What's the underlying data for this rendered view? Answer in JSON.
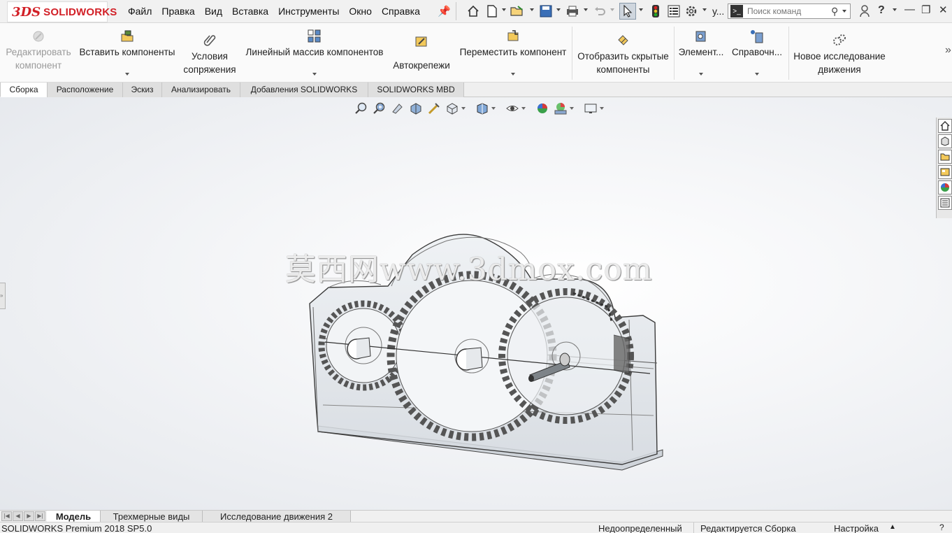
{
  "app": {
    "brand_mark": "3DS",
    "brand_name": "SOLIDWORKS"
  },
  "menu": [
    "Файл",
    "Правка",
    "Вид",
    "Вставка",
    "Инструменты",
    "Окно",
    "Справка"
  ],
  "quick_access": {
    "truncated_label": "у..."
  },
  "search": {
    "placeholder": "Поиск команд"
  },
  "command_manager": {
    "edit_component": "Редактировать компонент",
    "insert_components": "Вставить компоненты",
    "mate": "Условия сопряжения",
    "linear_pattern": "Линейный массив компонентов",
    "smart_fasteners": "Автокрепежи",
    "move_component": "Переместить компонент",
    "show_hidden": "Отобразить скрытые компоненты",
    "assembly_features": "Элемент...",
    "reference_geometry": "Справочн...",
    "new_motion_study": "Новое исследование движения",
    "more": "»"
  },
  "tabs": [
    "Сборка",
    "Расположение",
    "Эскиз",
    "Анализировать",
    "Добавления SOLIDWORKS",
    "SOLIDWORKS MBD"
  ],
  "active_tab": "Сборка",
  "watermark": "莫西网www.3dmox.com",
  "bottom_tabs": [
    "Модель",
    "Трехмерные виды",
    "Исследование движения 2"
  ],
  "status": {
    "product": "SOLIDWORKS Premium 2018 SP5.0",
    "definition": "Недоопределенный",
    "editing": "Редактируется Сборка",
    "customize": "Настройка"
  },
  "colors": {
    "brand": "#d22027",
    "accent": "#2a6fb5"
  }
}
